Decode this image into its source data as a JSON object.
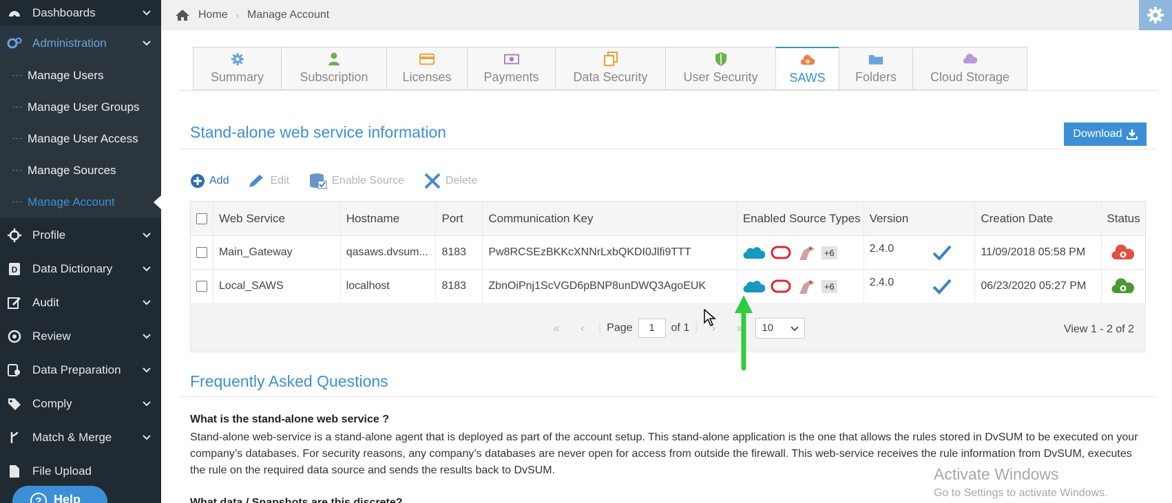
{
  "sidebar": {
    "items": [
      {
        "label": "Dashboards",
        "icon": "dashboard-icon"
      },
      {
        "label": "Administration",
        "icon": "gears-icon"
      },
      {
        "label": "Profile",
        "icon": "crosshair-icon"
      },
      {
        "label": "Data Dictionary",
        "icon": "dictionary-icon"
      },
      {
        "label": "Audit",
        "icon": "edit-icon"
      },
      {
        "label": "Review",
        "icon": "review-icon"
      },
      {
        "label": "Data Preparation",
        "icon": "data-prep-icon"
      },
      {
        "label": "Comply",
        "icon": "tag-icon"
      },
      {
        "label": "Match & Merge",
        "icon": "merge-icon"
      },
      {
        "label": "File Upload",
        "icon": "file-icon"
      }
    ],
    "admin_sub": [
      {
        "label": "Manage Users"
      },
      {
        "label": "Manage User Groups"
      },
      {
        "label": "Manage User Access"
      },
      {
        "label": "Manage Sources"
      },
      {
        "label": "Manage Account"
      }
    ],
    "help_label": "Help"
  },
  "breadcrumb": {
    "home": "Home",
    "current": "Manage Account"
  },
  "tabs": [
    {
      "label": "Summary",
      "icon": "gear-icon",
      "color": "#6aa3dd"
    },
    {
      "label": "Subscription",
      "icon": "user-icon",
      "color": "#6ab04c"
    },
    {
      "label": "Licenses",
      "icon": "card-icon",
      "color": "#f0a030"
    },
    {
      "label": "Payments",
      "icon": "money-icon",
      "color": "#a07ac8"
    },
    {
      "label": "Data Security",
      "icon": "copy-icon",
      "color": "#f0a030"
    },
    {
      "label": "User Security",
      "icon": "shield-icon",
      "color": "#6ab04c"
    },
    {
      "label": "SAWS",
      "icon": "cloud-gear-icon",
      "color": "#f08040"
    },
    {
      "label": "Folders",
      "icon": "folder-icon",
      "color": "#6aa3dd"
    },
    {
      "label": "Cloud Storage",
      "icon": "cloud-icon",
      "color": "#a07ac8"
    }
  ],
  "active_tab": "SAWS",
  "section": {
    "title": "Stand-alone web service information",
    "download_label": "Download"
  },
  "toolbar": {
    "add": "Add",
    "edit": "Edit",
    "enable_source": "Enable Source",
    "delete": "Delete"
  },
  "table": {
    "columns": [
      "Web Service",
      "Hostname",
      "Port",
      "Communication Key",
      "Enabled Source Types",
      "Version",
      "Creation Date",
      "Status"
    ],
    "rows": [
      {
        "web_service": "Main_Gateway",
        "hostname": "qasaws.dvsum...",
        "port": "8183",
        "key": "Pw8RCSEzBKKcXNNrLxbQKDI0Jlfi9TTT",
        "more": "+6",
        "version": "2.4.0",
        "date": "11/09/2018 05:58 PM",
        "status_color": "#e05040"
      },
      {
        "web_service": "Local_SAWS",
        "hostname": "localhost",
        "port": "8183",
        "key": "ZbnOiPnj1ScVGD6pBNP8unDWQ3AgoEUK",
        "more": "+6",
        "version": "2.4.0",
        "date": "06/23/2020 05:27 PM",
        "status_color": "#4a9a30"
      }
    ]
  },
  "pager": {
    "page_label": "Page",
    "page_value": "1",
    "of_label": "of 1",
    "page_size": "10",
    "view_info": "View 1 - 2 of 2"
  },
  "faq": {
    "title": "Frequently Asked Questions",
    "q1": "What is the stand-alone web service ?",
    "a1": "Stand-alone web-service is a stand-alone agent that is deployed as part of the account setup. This stand-alone application is the one that allows the rules stored in DvSUM to be executed on your company’s databases. For security reasons, any company’s databases are never open for access from outside the firewall. This web-service receives the rule information from DvSUM, executes the rule on the required data source and sends the results back to DvSUM.",
    "q2": "What data / Snapshots are this discrete?"
  },
  "watermark": {
    "line1": "Activate Windows",
    "line2": "Go to Settings to activate Windows."
  },
  "colors": {
    "accent": "#3c8fd6",
    "sidebar_bg": "#1f2a33",
    "arrow": "#2ecc40"
  }
}
